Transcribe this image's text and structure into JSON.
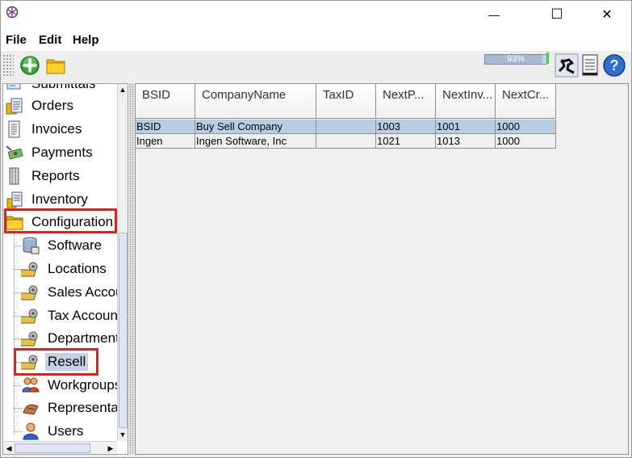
{
  "window": {
    "controls": {
      "minimize": "—",
      "maximize": "☐",
      "close": "✕"
    }
  },
  "menubar": {
    "items": [
      "File",
      "Edit",
      "Help"
    ]
  },
  "toolbar": {
    "buttons": [
      "add-icon",
      "folder-icon"
    ],
    "progress": {
      "percent": 93,
      "label": "93%"
    },
    "right_icons": [
      "robot-icon",
      "notepad-icon",
      "help-icon"
    ]
  },
  "sidebar": {
    "items": [
      {
        "label": "Submittals",
        "icon": "submittals-icon",
        "level": 0
      },
      {
        "label": "Orders",
        "icon": "orders-icon",
        "level": 0
      },
      {
        "label": "Invoices",
        "icon": "invoices-icon",
        "level": 0
      },
      {
        "label": "Payments",
        "icon": "payments-icon",
        "level": 0
      },
      {
        "label": "Reports",
        "icon": "reports-icon",
        "level": 0
      },
      {
        "label": "Inventory",
        "icon": "inventory-icon",
        "level": 0
      },
      {
        "label": "Configuration",
        "icon": "configuration-folder-icon",
        "level": 0,
        "highlighted": true
      },
      {
        "label": "Software",
        "icon": "software-icon",
        "level": 1
      },
      {
        "label": "Locations",
        "icon": "gears-icon",
        "level": 1
      },
      {
        "label": "Sales Accounts",
        "icon": "gears-icon",
        "level": 1
      },
      {
        "label": "Tax Accounts",
        "icon": "gears-icon",
        "level": 1
      },
      {
        "label": "Departments",
        "icon": "gears-icon",
        "level": 1
      },
      {
        "label": "Resell",
        "icon": "gears-icon",
        "level": 1,
        "selected": true,
        "highlighted": true
      },
      {
        "label": "Workgroups",
        "icon": "workgroups-icon",
        "level": 1
      },
      {
        "label": "Representatives",
        "icon": "representatives-icon",
        "level": 1
      },
      {
        "label": "Users",
        "icon": "users-icon",
        "level": 1
      }
    ]
  },
  "table": {
    "columns": [
      "BSID",
      "CompanyName",
      "TaxID",
      "NextP...",
      "NextInv...",
      "NextCr..."
    ],
    "rows": [
      [
        "BSID",
        "Buy Sell Company",
        "",
        "1003",
        "1001",
        "1000"
      ],
      [
        "Ingen",
        "Ingen Software, Inc",
        "",
        "1021",
        "1013",
        "1000"
      ]
    ],
    "selected_row": 0
  },
  "colors": {
    "highlight_box": "#e01f1f",
    "selection": "#b9cde5",
    "progress_end": "#3fd23f"
  }
}
